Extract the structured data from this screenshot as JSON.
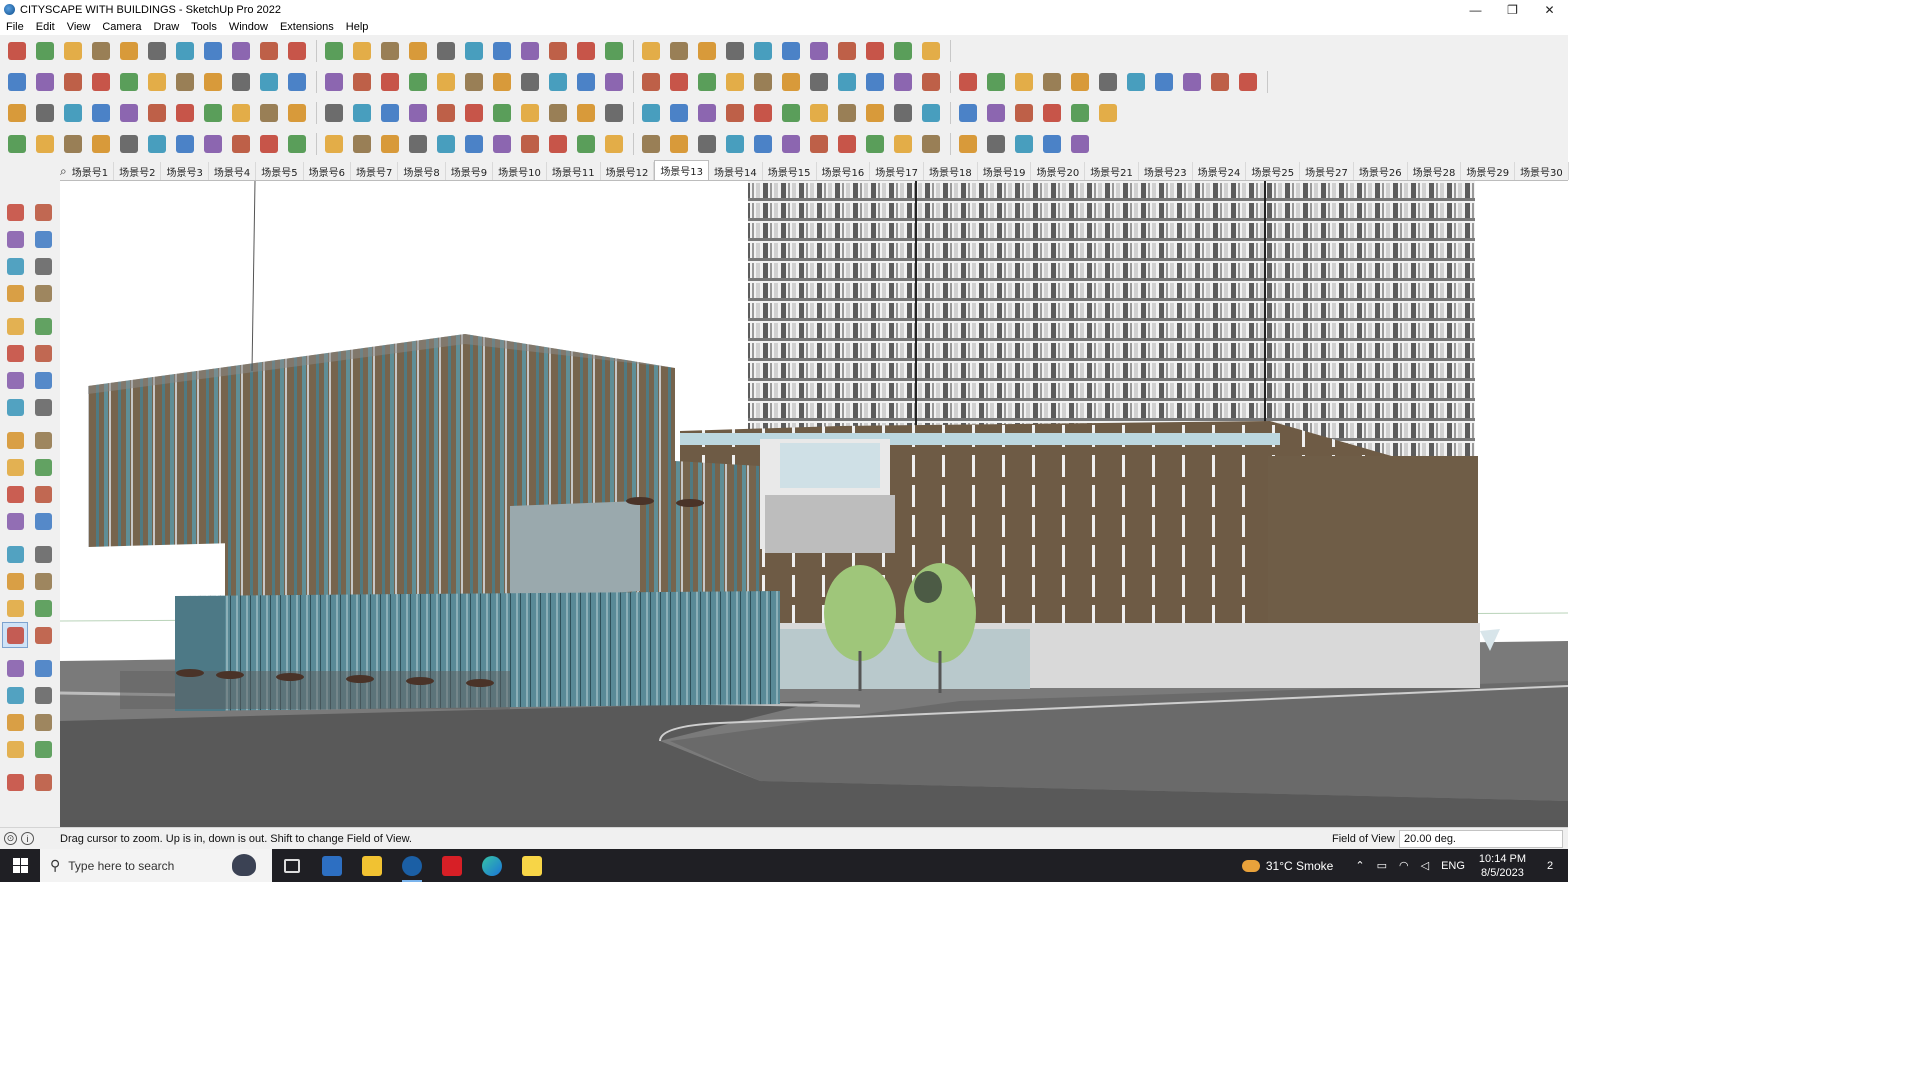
{
  "window": {
    "title": "CITYSCAPE WITH BUILDINGS - SketchUp Pro 2022",
    "minimize": "—",
    "maximize": "❐",
    "close": "✕"
  },
  "menu": {
    "items": [
      "File",
      "Edit",
      "View",
      "Camera",
      "Draw",
      "Tools",
      "Window",
      "Extensions",
      "Help"
    ]
  },
  "scenes": {
    "search_icon": "⌕",
    "active_index": 12,
    "tabs": [
      "场景号1",
      "场景号2",
      "场景号3",
      "场景号4",
      "场景号5",
      "场景号6",
      "场景号7",
      "场景号8",
      "场景号9",
      "场景号10",
      "场景号11",
      "场景号12",
      "场景号13",
      "场景号14",
      "场景号15",
      "场景号16",
      "场景号17",
      "场景号18",
      "场景号19",
      "场景号20",
      "场景号21",
      "场景号23",
      "场景号24",
      "场景号25",
      "场景号27",
      "场景号26",
      "场景号28",
      "场景号29",
      "场景号30"
    ]
  },
  "toolbar_icons": {
    "row1": [
      "zoom-icon",
      "select-icon",
      "eraser-icon",
      "line-icon",
      "arc-icon",
      "rectangle-icon",
      "push-pull-icon",
      "follow-me-icon",
      "move-icon",
      "rotate-icon",
      "scale-icon",
      "tape-measure-icon",
      "text-icon",
      "paint-bucket-icon",
      "orbit-icon",
      "pan-icon",
      "zoom-tool-icon",
      "zoom-extents-icon",
      "component-icon",
      "section-icon",
      "layers-icon",
      "outliner-icon",
      "styles-icon",
      "shadows-icon",
      "fog-icon",
      "scenes-icon",
      "up-down-icon",
      "x-ray-icon",
      "axis-icon",
      "match-photo-icon",
      "undo-icon",
      "redo-icon",
      "paste-icon"
    ],
    "row2": [
      "box-icon",
      "cube-icon",
      "cube-alt-icon",
      "push-red-icon",
      "extrude-blue-icon",
      "extrude-red-icon",
      "extrude-green-icon",
      "extrude-orange-icon",
      "extrude-orange2-icon",
      "extrude-magenta-icon",
      "path-icon",
      "slice-blue-icon",
      "slice-purple-icon",
      "slice-violet-icon",
      "surface-green-icon",
      "surface-star-icon",
      "house-dark-icon",
      "house-book-icon",
      "house-icon",
      "house-roof-icon",
      "house-outline-icon",
      "house-base-icon",
      "function-icon",
      "leaf-icon",
      "pencil-red-icon",
      "shape-square-icon",
      "shape-circle-icon",
      "shape-pentagon-icon",
      "shape-ellipse-icon",
      "shape-parallelogram-icon",
      "shape-arc-icon",
      "shape-circle2-icon",
      "shape-hex-icon",
      "shape-polygon-icon",
      "shape-gear-icon",
      "arrow-red-icon",
      "eraser-pink-icon",
      "brick-icon",
      "brick-alt-icon",
      "roof-red-icon",
      "roof-dark-icon",
      "roof-stone-icon",
      "roof-slab-icon",
      "roof-slope-icon"
    ],
    "row3": [
      "layer-blue-icon",
      "layer-blue2-icon",
      "layer-yellow-icon",
      "layer-green-icon",
      "layer-red-icon",
      "layer-gray-icon",
      "loop-orange-icon",
      "square-red-icon",
      "stripes-red-icon",
      "flag-icon",
      "block-icon",
      "link-icon",
      "curve-icon",
      "dots-red-icon",
      "cross-red-icon",
      "cross-green-icon",
      "cross-blue-icon",
      "cone-blue-icon",
      "cone-green-icon",
      "warning-icon",
      "loop-orange2-icon",
      "loop-red-icon",
      "loop-dark-icon",
      "nodes-blue-icon",
      "bucket-icon",
      "undo-red-icon",
      "tree-green-icon",
      "gear-red-icon",
      "gear-red2-icon",
      "corner-icon",
      "cube-red-icon",
      "gear-gold-icon",
      "frame-icon",
      "grid-orange-icon",
      "grid-orange2-icon",
      "grid-orange3-icon",
      "x-red-icon",
      "curve-dark-icon",
      "grid-dark-icon"
    ],
    "row4": [
      "polyline-icon",
      "bezier-icon",
      "curve-red-icon",
      "scissors-icon",
      "gear-outline-icon",
      "plane-icon",
      "sweep-icon",
      "box-outline-icon",
      "sphere-icon",
      "twist-icon",
      "corner-line-icon",
      "corner-line2-icon",
      "diagonal-red-icon",
      "arc-red-icon",
      "arch-icon",
      "arches-icon",
      "pillars-icon",
      "hands-icon",
      "leaf-outline-icon",
      "wedge-icon",
      "bars-icon",
      "triangle-icon",
      "slope-icon",
      "slope2-icon",
      "slope3-icon",
      "barrel-icon",
      "hatch-icon",
      "doc-icon",
      "doc2-icon",
      "hatch-dark-icon",
      "hatch-dark2-icon",
      "hatch-dark3-icon",
      "columns-icon",
      "sphere-dark-icon",
      "sphere-dark2-icon",
      "hatch-slope-icon",
      "fan-icon",
      "polygon-outline-icon"
    ]
  },
  "left_tools": [
    "select-icon",
    "orbit-icon",
    "paint-bucket-icon",
    "eraser-icon",
    "component-icon",
    "tape-icon",
    "line-icon",
    "freehand-icon",
    "rectangle-icon",
    "rotated-rect-icon",
    "circle-icon",
    "polygon-icon",
    "arc-icon",
    "arc2-icon",
    "pie-icon",
    "arc3-icon",
    "move-icon",
    "push-pull-icon",
    "rotate-icon",
    "follow-me-icon",
    "scale-icon",
    "offset-icon",
    "tape-measure-icon",
    "dimension-icon",
    "protractor-icon",
    "text-icon",
    "axes-icon",
    "3d-text-icon",
    "orbit-tool-icon",
    "pan-tool-icon",
    "zoom-tool-icon",
    "zoom-window-icon",
    "zoom-extents-icon",
    "zoom-prev-icon",
    "position-camera-icon",
    "look-around-icon",
    "walk-icon",
    "section-plane-icon",
    "components-icon",
    "styles-icon",
    "layers-icon",
    "scenes-icon"
  ],
  "status": {
    "hint": "Drag cursor to zoom.  Up is in, down is out. Shift to change Field of View.",
    "vcb_label": "Field of View",
    "vcb_value": "20.00 deg."
  },
  "taskbar": {
    "search_placeholder": "Type here to search",
    "search_glyph": "⚲",
    "apps": [
      "task-view-icon",
      "calculator-icon",
      "file-explorer-icon",
      "sketchup-icon",
      "acrobat-icon",
      "edge-icon",
      "sticky-notes-icon"
    ],
    "active_app": "sketchup-icon",
    "weather": "31°C  Smoke",
    "language": "ENG",
    "time": "10:14 PM",
    "date": "8/5/2023",
    "notifications": "2"
  }
}
